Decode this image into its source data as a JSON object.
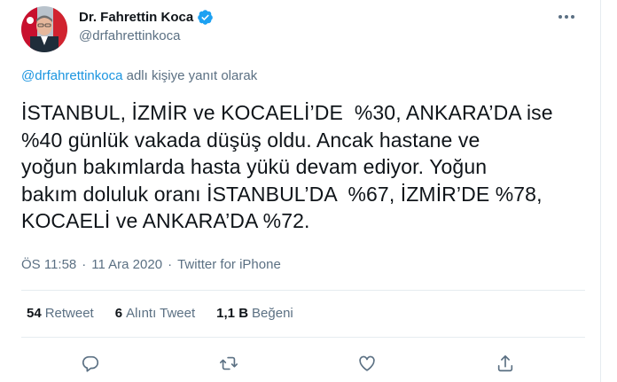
{
  "author": {
    "display_name": "Dr. Fahrettin Koca",
    "handle": "@drfahrettinkoca",
    "verified": true
  },
  "reply_context": {
    "mention": "@drfahrettinkoca",
    "suffix": " adlı kişiye yanıt olarak"
  },
  "tweet": {
    "text": "İSTANBUL, İZMİR ve KOCAELİ’DE  %30, ANKARA’DA ise\n%40 günlük vakada düşüş oldu. Ancak hastane ve\nyoğun bakımlarda hasta yükü devam ediyor. Yoğun\nbakım doluluk oranı İSTANBUL’DA  %67, İZMİR’DE %78,\nKOCAELİ ve ANKARA’DA %72."
  },
  "meta": {
    "time": "ÖS 11:58",
    "separator": "·",
    "date": "11 Ara 2020",
    "source": "Twitter for iPhone"
  },
  "stats": {
    "retweets": {
      "count": "54",
      "label": "Retweet"
    },
    "quotes": {
      "count": "6",
      "label": "Alıntı Tweet"
    },
    "likes": {
      "count": "1,1 B",
      "label": "Beğeni"
    }
  },
  "actions": [
    "reply-icon",
    "retweet-icon",
    "like-icon",
    "share-icon"
  ],
  "colors": {
    "text_primary": "#0f1419",
    "text_secondary": "#5b7083",
    "link": "#1b95e0",
    "verified": "#1da1f2",
    "divider": "#e6ecf0"
  }
}
